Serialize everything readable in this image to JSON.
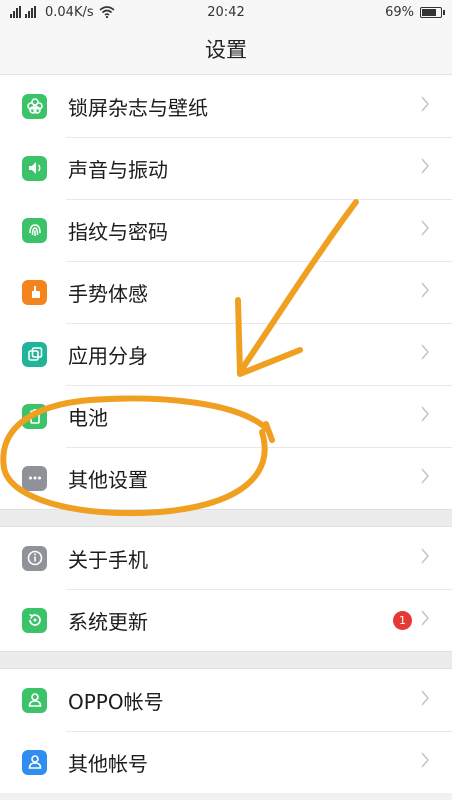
{
  "status_bar": {
    "network_speed": "0.04K/s",
    "time": "20:42",
    "battery_percent": "69%",
    "battery_level": 0.69
  },
  "header": {
    "title": "设置"
  },
  "groups": [
    {
      "items": [
        {
          "label": "锁屏杂志与壁纸",
          "icon": "flower-icon",
          "color": "#3cc36a"
        },
        {
          "label": "声音与振动",
          "icon": "speaker-icon",
          "color": "#3cc36a"
        },
        {
          "label": "指纹与密码",
          "icon": "fingerprint-icon",
          "color": "#3cc36a"
        },
        {
          "label": "手势体感",
          "icon": "hand-gesture-icon",
          "color": "#f5841f"
        },
        {
          "label": "应用分身",
          "icon": "clone-app-icon",
          "color": "#20b49a"
        },
        {
          "label": "电池",
          "icon": "battery-icon",
          "color": "#3cc36a"
        },
        {
          "label": "其他设置",
          "icon": "more-dots-icon",
          "color": "#8f9399"
        }
      ]
    },
    {
      "items": [
        {
          "label": "关于手机",
          "icon": "info-icon",
          "color": "#8f9399"
        },
        {
          "label": "系统更新",
          "icon": "update-icon",
          "color": "#3cc36a",
          "badge": "1"
        }
      ]
    },
    {
      "items": [
        {
          "label": "OPPO帐号",
          "icon": "user-account-icon",
          "color": "#3cc36a"
        },
        {
          "label": "其他帐号",
          "icon": "other-account-icon",
          "color": "#2f8ef0"
        }
      ]
    }
  ],
  "annotation": {
    "color": "#f0a020"
  }
}
